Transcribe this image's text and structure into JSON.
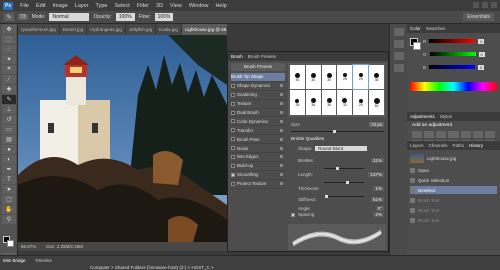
{
  "app": {
    "logo": "Ps",
    "menu": [
      "File",
      "Edit",
      "Image",
      "Layer",
      "Type",
      "Select",
      "Filter",
      "3D",
      "View",
      "Window",
      "Help"
    ]
  },
  "options": {
    "mode_label": "Mode:",
    "mode_value": "Normal",
    "opacity_label": "Opacity:",
    "opacity_value": "100%",
    "flow_label": "Flow:",
    "flow_value": "100%",
    "workspace": "Essentials"
  },
  "doc_tabs": [
    "ryuanthemum.jpg",
    "Desert.jpg",
    "Hydrangeas.jpg",
    "Jellyfish.jpg",
    "Koala.jpg",
    "Lighthouse.jpg @ 66.7% (RGB/8#)"
  ],
  "status": {
    "zoom": "66.67%",
    "doc": "Doc: 2.25M/2.25M"
  },
  "bottom": {
    "tabs": [
      "Mini Bridge",
      "Timeline"
    ],
    "path": "Computer > Shared Folders (\\\\vmware-host) (Z:) > HGST_C >"
  },
  "brush_panel": {
    "tabs": [
      "Brush",
      "Brush Presets"
    ],
    "presets_button": "Brush Presets",
    "options": [
      {
        "label": "Brush Tip Shape",
        "selected": true,
        "checkbox": false,
        "checked": false
      },
      {
        "label": "Shape Dynamics",
        "checkbox": true,
        "checked": false
      },
      {
        "label": "Scattering",
        "checkbox": true,
        "checked": false
      },
      {
        "label": "Texture",
        "checkbox": true,
        "checked": false
      },
      {
        "label": "Dual Brush",
        "checkbox": true,
        "checked": false
      },
      {
        "label": "Color Dynamics",
        "checkbox": true,
        "checked": false
      },
      {
        "label": "Transfer",
        "checkbox": true,
        "checked": false
      },
      {
        "label": "Brush Pose",
        "checkbox": true,
        "checked": false
      },
      {
        "label": "Noise",
        "checkbox": true,
        "checked": false
      },
      {
        "label": "Wet Edges",
        "checkbox": true,
        "checked": false
      },
      {
        "label": "Build-up",
        "checkbox": true,
        "checked": false
      },
      {
        "label": "Smoothing",
        "checkbox": true,
        "checked": true
      },
      {
        "label": "Protect Texture",
        "checkbox": true,
        "checked": false
      }
    ],
    "tips": [
      "30",
      "30",
      "30",
      "25",
      "25",
      "36",
      "25",
      "36",
      "36",
      "32",
      "25",
      "50"
    ],
    "size_label": "Size",
    "size_value": "73 px",
    "bristle_title": "Bristle Qualities",
    "shape_label": "Shape:",
    "shape_value": "Round Blunt",
    "params": [
      {
        "label": "Bristles:",
        "value": "31%",
        "frac": 0.31
      },
      {
        "label": "Length:",
        "value": "137%",
        "frac": 0.55
      },
      {
        "label": "Thickness:",
        "value": "1%",
        "frac": 0.02
      },
      {
        "label": "Stiffness:",
        "value": "51%",
        "frac": 0.51
      },
      {
        "label": "Angle:",
        "value": "0°",
        "frac": 0.5
      }
    ],
    "spacing_label": "Spacing",
    "spacing_value": "2%"
  },
  "right": {
    "color_tabs": [
      "Color",
      "Swatches"
    ],
    "rgb": [
      {
        "ch": "R",
        "v": "0"
      },
      {
        "ch": "G",
        "v": "0"
      },
      {
        "ch": "B",
        "v": "0"
      }
    ],
    "adj_tabs": [
      "Adjustments",
      "Styles"
    ],
    "adj_title": "Add an adjustment",
    "layer_tabs": [
      "Layers",
      "Channels",
      "Paths",
      "History"
    ],
    "history_file": "Lighthouse.jpg",
    "history": [
      {
        "label": "Open",
        "state": "normal"
      },
      {
        "label": "Quick Selection",
        "state": "normal"
      },
      {
        "label": "Deselect",
        "state": "selected"
      },
      {
        "label": "Brush Tool",
        "state": "dim"
      },
      {
        "label": "Brush Tool",
        "state": "dim"
      },
      {
        "label": "Brush Tool",
        "state": "dim"
      }
    ]
  }
}
